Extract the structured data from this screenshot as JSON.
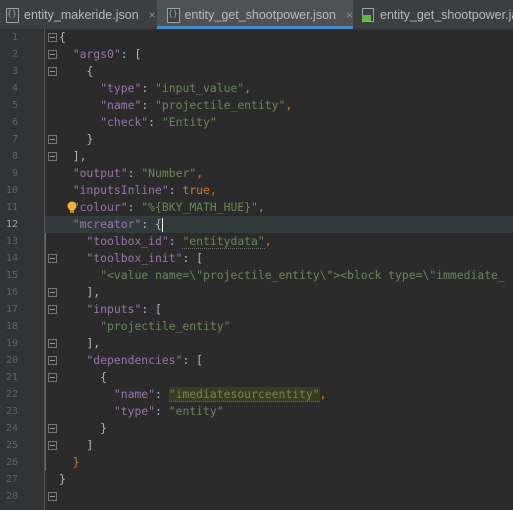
{
  "tabs": [
    {
      "label": "entity_makeride.json",
      "active": false
    },
    {
      "label": "entity_get_shootpower.json",
      "active": true
    },
    {
      "label": "entity_get_shootpower.java",
      "active": false
    }
  ],
  "close_glyph": "×",
  "line_numbers": [
    "1",
    "2",
    "3",
    "4",
    "5",
    "6",
    "7",
    "8",
    "9",
    "10",
    "11",
    "12",
    "13",
    "14",
    "15",
    "16",
    "17",
    "18",
    "19",
    "20",
    "21",
    "22",
    "23",
    "24",
    "25",
    "26",
    "27",
    "28"
  ],
  "code": {
    "l1": "{",
    "l2_key": "\"args0\"",
    "l2_rest": ": [",
    "l3": "{",
    "l4_key": "\"type\"",
    "l4_val": "\"input_value\"",
    "l5_key": "\"name\"",
    "l5_val": "\"projectile_entity\"",
    "l6_key": "\"check\"",
    "l6_val": "\"Entity\"",
    "l7": "}",
    "l8": "],",
    "l9_key": "\"output\"",
    "l9_val": "\"Number\"",
    "l10_key": "\"inputsInline\"",
    "l10_val": "true",
    "l11_key": "\"colour\"",
    "l11_val": "\"%{BKY_MATH_HUE}\"",
    "l12_key": "\"mcreator\"",
    "l12_rest": ": {",
    "l13_key": "\"toolbox_id\"",
    "l13_val": "\"entitydata\"",
    "l14_key": "\"toolbox_init\"",
    "l14_rest": ": [",
    "l15_val": "\"<value name=\\\"projectile_entity\\\"><block type=\\\"immediate_",
    "l16": "],",
    "l17_key": "\"inputs\"",
    "l17_rest": ": [",
    "l18_val": "\"projectile_entity\"",
    "l19": "],",
    "l20_key": "\"dependencies\"",
    "l20_rest": ": [",
    "l21": "{",
    "l22_key": "\"name\"",
    "l22_val": "\"imediatesourceentity\"",
    "l23_key": "\"type\"",
    "l23_val": "\"entity\"",
    "l24": "}",
    "l25": "]",
    "l26": "}",
    "l27": "}"
  },
  "colors": {
    "background": "#2b2b2b",
    "key": "#9876aa",
    "string": "#6a8759",
    "keyword": "#cc7832",
    "accent": "#4a88c7"
  }
}
